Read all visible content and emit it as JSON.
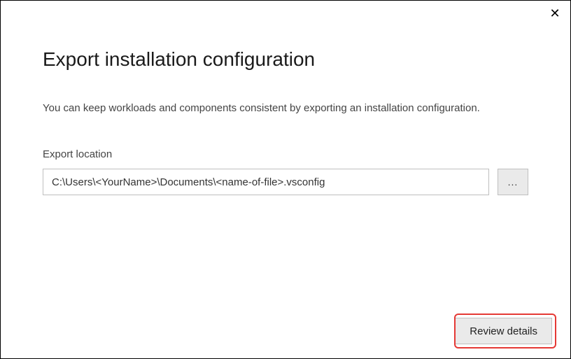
{
  "dialog": {
    "title": "Export installation configuration",
    "description": "You can keep workloads and components consistent by exporting an installation configuration.",
    "close_icon": "✕"
  },
  "form": {
    "location_label": "Export location",
    "path_value": "C:\\Users\\<YourName>\\Documents\\<name-of-file>.vsconfig",
    "browse_label": "..."
  },
  "actions": {
    "review_label": "Review details"
  }
}
